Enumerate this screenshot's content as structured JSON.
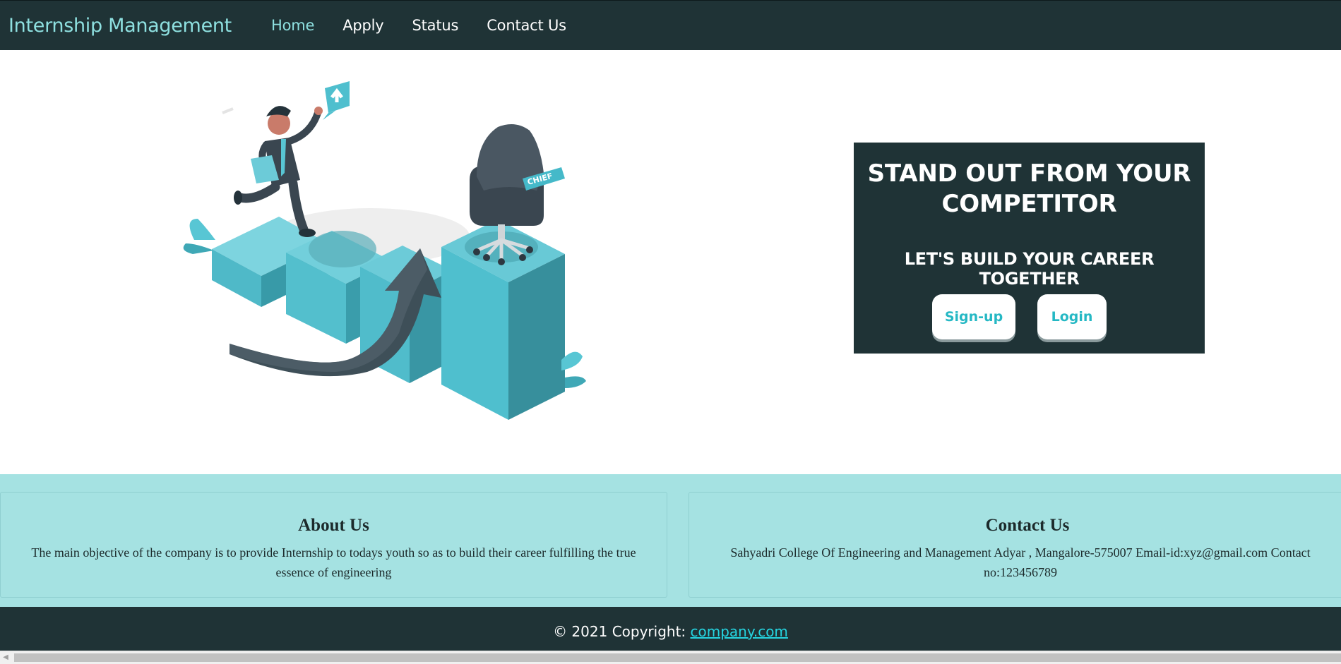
{
  "navbar": {
    "brand": "Internship Management",
    "links": [
      "Home",
      "Apply",
      "Status",
      "Contact Us"
    ]
  },
  "hero": {
    "illustration_icon": "career-growth-illustration",
    "cta_title": "STAND OUT FROM YOUR COMPETITOR",
    "cta_subtitle": "LET'S BUILD YOUR CAREER TOGETHER",
    "signup_label": "Sign-up",
    "login_label": "Login",
    "chair_label": "CHIEF"
  },
  "about": {
    "title": "About Us",
    "text": "The main objective of the company is to provide Internship to todays youth so as to build their career fulfilling the true essence of engineering"
  },
  "contact": {
    "title": "Contact Us",
    "text": "Sahyadri College Of Engineering and Management Adyar , Mangalore-575007 Email-id:xyz@gmail.com Contact no:123456789"
  },
  "footer": {
    "copyright": "© 2021 Copyright: ",
    "link": "company.com"
  },
  "colors": {
    "nav_bg": "#1f3336",
    "accent": "#8ee0e0",
    "info_bg": "#a5e2e2",
    "button_text": "#25b8c4"
  }
}
